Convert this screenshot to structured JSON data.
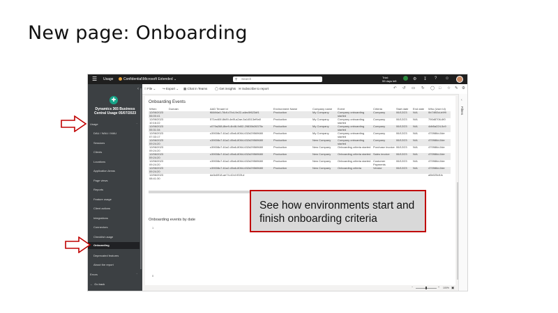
{
  "slide": {
    "title": "New page: Onboarding"
  },
  "callout": {
    "text": "See how environments start and finish onboarding criteria"
  },
  "topbar": {
    "app": "Usage",
    "workspace": "Confidential\\Microsoft Extended",
    "search_placeholder": "Search",
    "trial_line1": "Trial:",
    "trial_line2": "59 days left",
    "notification_count": "4"
  },
  "nav": {
    "app_name_line1": "Dynamics 365 Business",
    "app_name_line2": "Central Usage 05/07/2023",
    "group_usage": "Usage",
    "group_errors": "Errors",
    "items": [
      "DAU / WAU / MAU",
      "Sessions",
      "Clients",
      "Locations",
      "Application Areas",
      "Page views",
      "Reports",
      "Feature usage",
      "Client actions",
      "Integrations",
      "Connectors",
      "Checklist usage",
      "Onboarding",
      "Deprecated features",
      "About the report"
    ],
    "selected": "Onboarding",
    "go_back": "Go back"
  },
  "toolbar": {
    "file": "File",
    "export": "Export",
    "chat": "Chat in Teams",
    "insights": "Get insights",
    "subscribe": "Subscribe to report"
  },
  "table": {
    "title": "Onboarding Events",
    "columns": [
      "When",
      "Domain",
      "AAD Tenant Id",
      "Environment Name",
      "Company name",
      "Event",
      "Criteria",
      "Start date",
      "End date",
      "Who (User Id)"
    ],
    "rows": [
      [
        "12/06/2023 06:00:41",
        "",
        "f684f4a0-78df-47b4-9e22-a4ec5f623df1",
        "Production",
        "My Company",
        "Company onboarding started",
        "Company",
        "06/12/23",
        "N/A",
        "0b74f53d-b9f9"
      ],
      [
        "12/06/2023 10:16:22",
        "",
        "571ec60f-8b89-4e8f-a2ae-5a14513ef9a0",
        "Production",
        "My Company",
        "Company onboarding started",
        "Company",
        "06/12/23",
        "N/A",
        "790d8706-6f0"
      ],
      [
        "12/06/2023 05:31:34",
        "",
        "c079a288-8be9-4b48-9d02-29835b26375c",
        "Production",
        "My Company",
        "Company onboarding started",
        "Company",
        "06/12/23",
        "N/A",
        "4db5a224-5c9"
      ],
      [
        "12/06/2023 07:33:17",
        "",
        "c39008c7-61a2-49a6-8064-632d29569680",
        "Production",
        "My Company",
        "Company onboarding started",
        "Company",
        "06/12/23",
        "N/A",
        "470986d-0de"
      ],
      [
        "12/06/2023 09:24:20",
        "",
        "c39008c7-61a2-49a6-8064-632d29569680",
        "Production",
        "New Company",
        "Company onboarding started",
        "Company",
        "06/12/23",
        "N/A",
        "470986d-0de"
      ],
      [
        "12/06/2023 09:24:20",
        "",
        "c39008c7-61a2-49a6-8064-632d29569680",
        "Production",
        "New Company",
        "Onboarding criteria started",
        "Purchase Invoice",
        "06/12/23",
        "N/A",
        "470986d-0de"
      ],
      [
        "12/06/2023 09:24:20",
        "",
        "c39008c7-61a2-49a6-8064-632d29569680",
        "Production",
        "New Company",
        "Onboarding criteria started",
        "Sales invoice",
        "06/12/23",
        "N/A",
        "470986d-0de"
      ],
      [
        "12/06/2023 09:24:20",
        "",
        "c39008c7-61a2-49a6-8064-632d29569680",
        "Production",
        "New Company",
        "Onboarding criteria started",
        "Customer Payments",
        "06/12/23",
        "N/A",
        "470986d-0de"
      ],
      [
        "12/06/2023 09:24:20",
        "",
        "c39008c7-61a2-49a6-8064-632d29569680",
        "Production",
        "New Company",
        "Onboarding criteria",
        "Vendor",
        "06/12/23",
        "N/A",
        "470986d-0de"
      ],
      [
        "12/06/2023 08:41:30",
        "",
        "da3c6918-ae74-42cf-933f-d",
        "",
        "",
        "",
        "",
        "",
        "",
        "a5b025df-fc"
      ]
    ]
  },
  "chart": {
    "title": "Onboarding events by date",
    "tick_top": "1",
    "tick_bottom": "0"
  },
  "filters": {
    "label": "Filters"
  },
  "status": {
    "zoom": "100%"
  }
}
